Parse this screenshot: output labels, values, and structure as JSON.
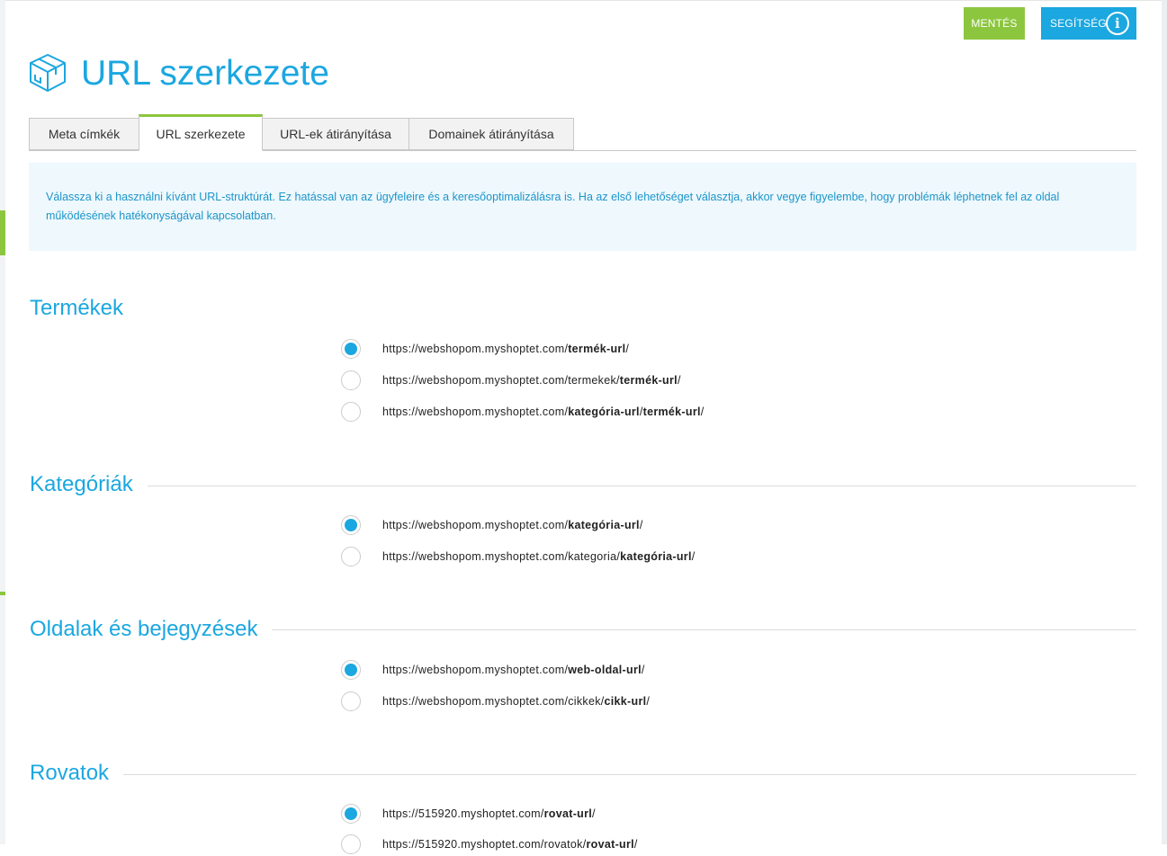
{
  "header": {
    "save_label": "MENTÉS",
    "help_label": "SEGÍTSÉG",
    "help_icon": "info-icon",
    "title": "URL szerkezete",
    "title_icon": "box-icon"
  },
  "tabs": [
    {
      "label": "Meta címkék",
      "active": false
    },
    {
      "label": "URL szerkezete",
      "active": true
    },
    {
      "label": "URL-ek átirányítása",
      "active": false
    },
    {
      "label": "Domainek átirányítása",
      "active": false
    }
  ],
  "info_text": "Válassza ki a használni kívánt URL-struktúrát. Ez hatással van az ügyfeleire és a keresőoptimalizálásra is. Ha az első lehetőséget választja, akkor vegye figyelembe, hogy problémák léphetnek fel az oldal működésének hatékonyságával kapcsolatban.",
  "sections": {
    "products": {
      "title": "Termékek",
      "options": [
        {
          "prefix": "https://webshopom.myshoptet.com/",
          "bold": "termék-url",
          "suffix": "/",
          "checked": true
        },
        {
          "prefix": "https://webshopom.myshoptet.com/termekek/",
          "bold": "termék-url",
          "suffix": "/",
          "checked": false
        },
        {
          "prefix": "https://webshopom.myshoptet.com/",
          "bold": "kategória-url",
          "mid": "/",
          "bold2": "termék-url",
          "suffix": "/",
          "checked": false
        }
      ]
    },
    "categories": {
      "title": "Kategóriák",
      "options": [
        {
          "prefix": "https://webshopom.myshoptet.com/",
          "bold": "kategória-url",
          "suffix": "/",
          "checked": true
        },
        {
          "prefix": "https://webshopom.myshoptet.com/kategoria/",
          "bold": "kategória-url",
          "suffix": "/",
          "checked": false
        }
      ]
    },
    "pages": {
      "title": "Oldalak és bejegyzések",
      "options": [
        {
          "prefix": "https://webshopom.myshoptet.com/",
          "bold": "web-oldal-url",
          "suffix": "/",
          "checked": true
        },
        {
          "prefix": "https://webshopom.myshoptet.com/cikkek/",
          "bold": "cikk-url",
          "suffix": "/",
          "checked": false
        }
      ]
    },
    "sections_rovatok": {
      "title": "Rovatok",
      "options": [
        {
          "prefix": "https://515920.myshoptet.com/",
          "bold": "rovat-url",
          "suffix": "/",
          "checked": true
        },
        {
          "prefix": "https://515920.myshoptet.com/rovatok/",
          "bold": "rovat-url",
          "suffix": "/",
          "checked": false
        }
      ]
    }
  },
  "colors": {
    "accent_blue": "#1ba7e0",
    "accent_green": "#8cc63f"
  }
}
